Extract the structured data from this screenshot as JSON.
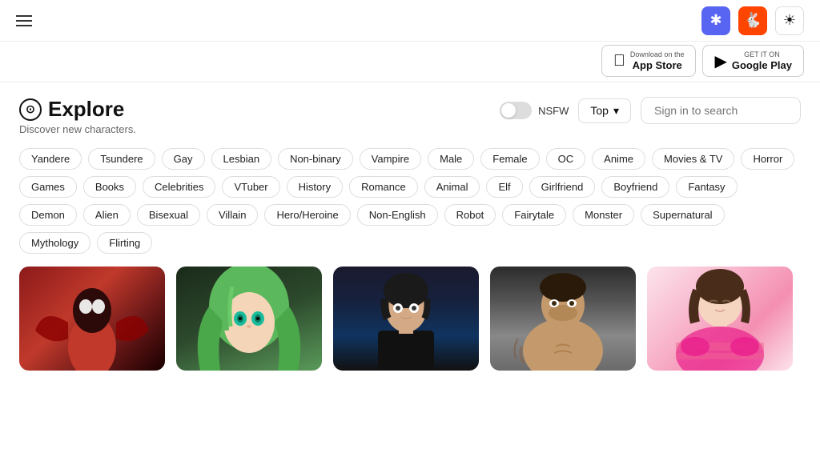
{
  "nav": {
    "hamburger_label": "Menu",
    "discord_icon": "discord",
    "reddit_icon": "reddit",
    "theme_icon": "☀"
  },
  "stores": {
    "app_store": {
      "sub": "Download on the",
      "name": "App Store"
    },
    "google_play": {
      "sub": "GET IT ON",
      "name": "Google Play"
    }
  },
  "explore": {
    "title": "Explore",
    "subtitle": "Discover new characters.",
    "nsfw_label": "NSFW",
    "top_label": "Top",
    "search_placeholder": "Sign in to search"
  },
  "tags": [
    "Yandere",
    "Tsundere",
    "Gay",
    "Lesbian",
    "Non-binary",
    "Vampire",
    "Male",
    "Female",
    "OC",
    "Anime",
    "Movies & TV",
    "Horror",
    "Games",
    "Books",
    "Celebrities",
    "VTuber",
    "History",
    "Romance",
    "Animal",
    "Elf",
    "Girlfriend",
    "Boyfriend",
    "Fantasy",
    "Demon",
    "Alien",
    "Bisexual",
    "Villain",
    "Hero/Heroine",
    "Non-English",
    "Robot",
    "Fairytale",
    "Monster",
    "Supernatural",
    "Mythology",
    "Flirting"
  ],
  "cards": [
    {
      "id": "card-1",
      "label": "Spider character"
    },
    {
      "id": "card-2",
      "label": "Green hair anime girl"
    },
    {
      "id": "card-3",
      "label": "Dark hair male"
    },
    {
      "id": "card-4",
      "label": "Muscular tattooed male"
    },
    {
      "id": "card-5",
      "label": "Girl in pink hoodie"
    }
  ],
  "colors": {
    "accent": "#5865F2",
    "reddit": "#FF4500",
    "tag_border": "#ddd"
  }
}
